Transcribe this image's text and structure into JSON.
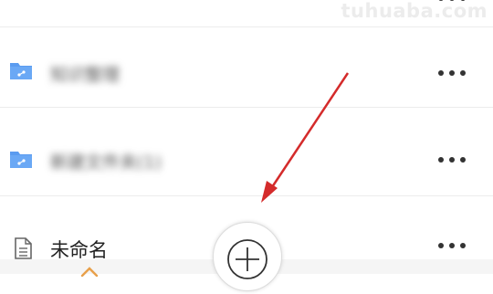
{
  "watermark": "tuhuaba.com",
  "file_list": {
    "items": [
      {
        "name": "知识整理",
        "kind": "folder",
        "icon": "folder-icon"
      },
      {
        "name": "新建文件夹(1)",
        "kind": "folder",
        "icon": "folder-icon"
      },
      {
        "name": "未命名",
        "kind": "document",
        "icon": "document-icon"
      }
    ],
    "more_icon": "more-options-icon"
  },
  "fab": {
    "icon": "plus-icon"
  },
  "annotation": {
    "color": "#d42b2b"
  },
  "colors": {
    "folder": "#5b9cf0",
    "divider": "#ececec",
    "bottom_bar": "#f5f5f5",
    "home_icon": "#e8a04a"
  }
}
